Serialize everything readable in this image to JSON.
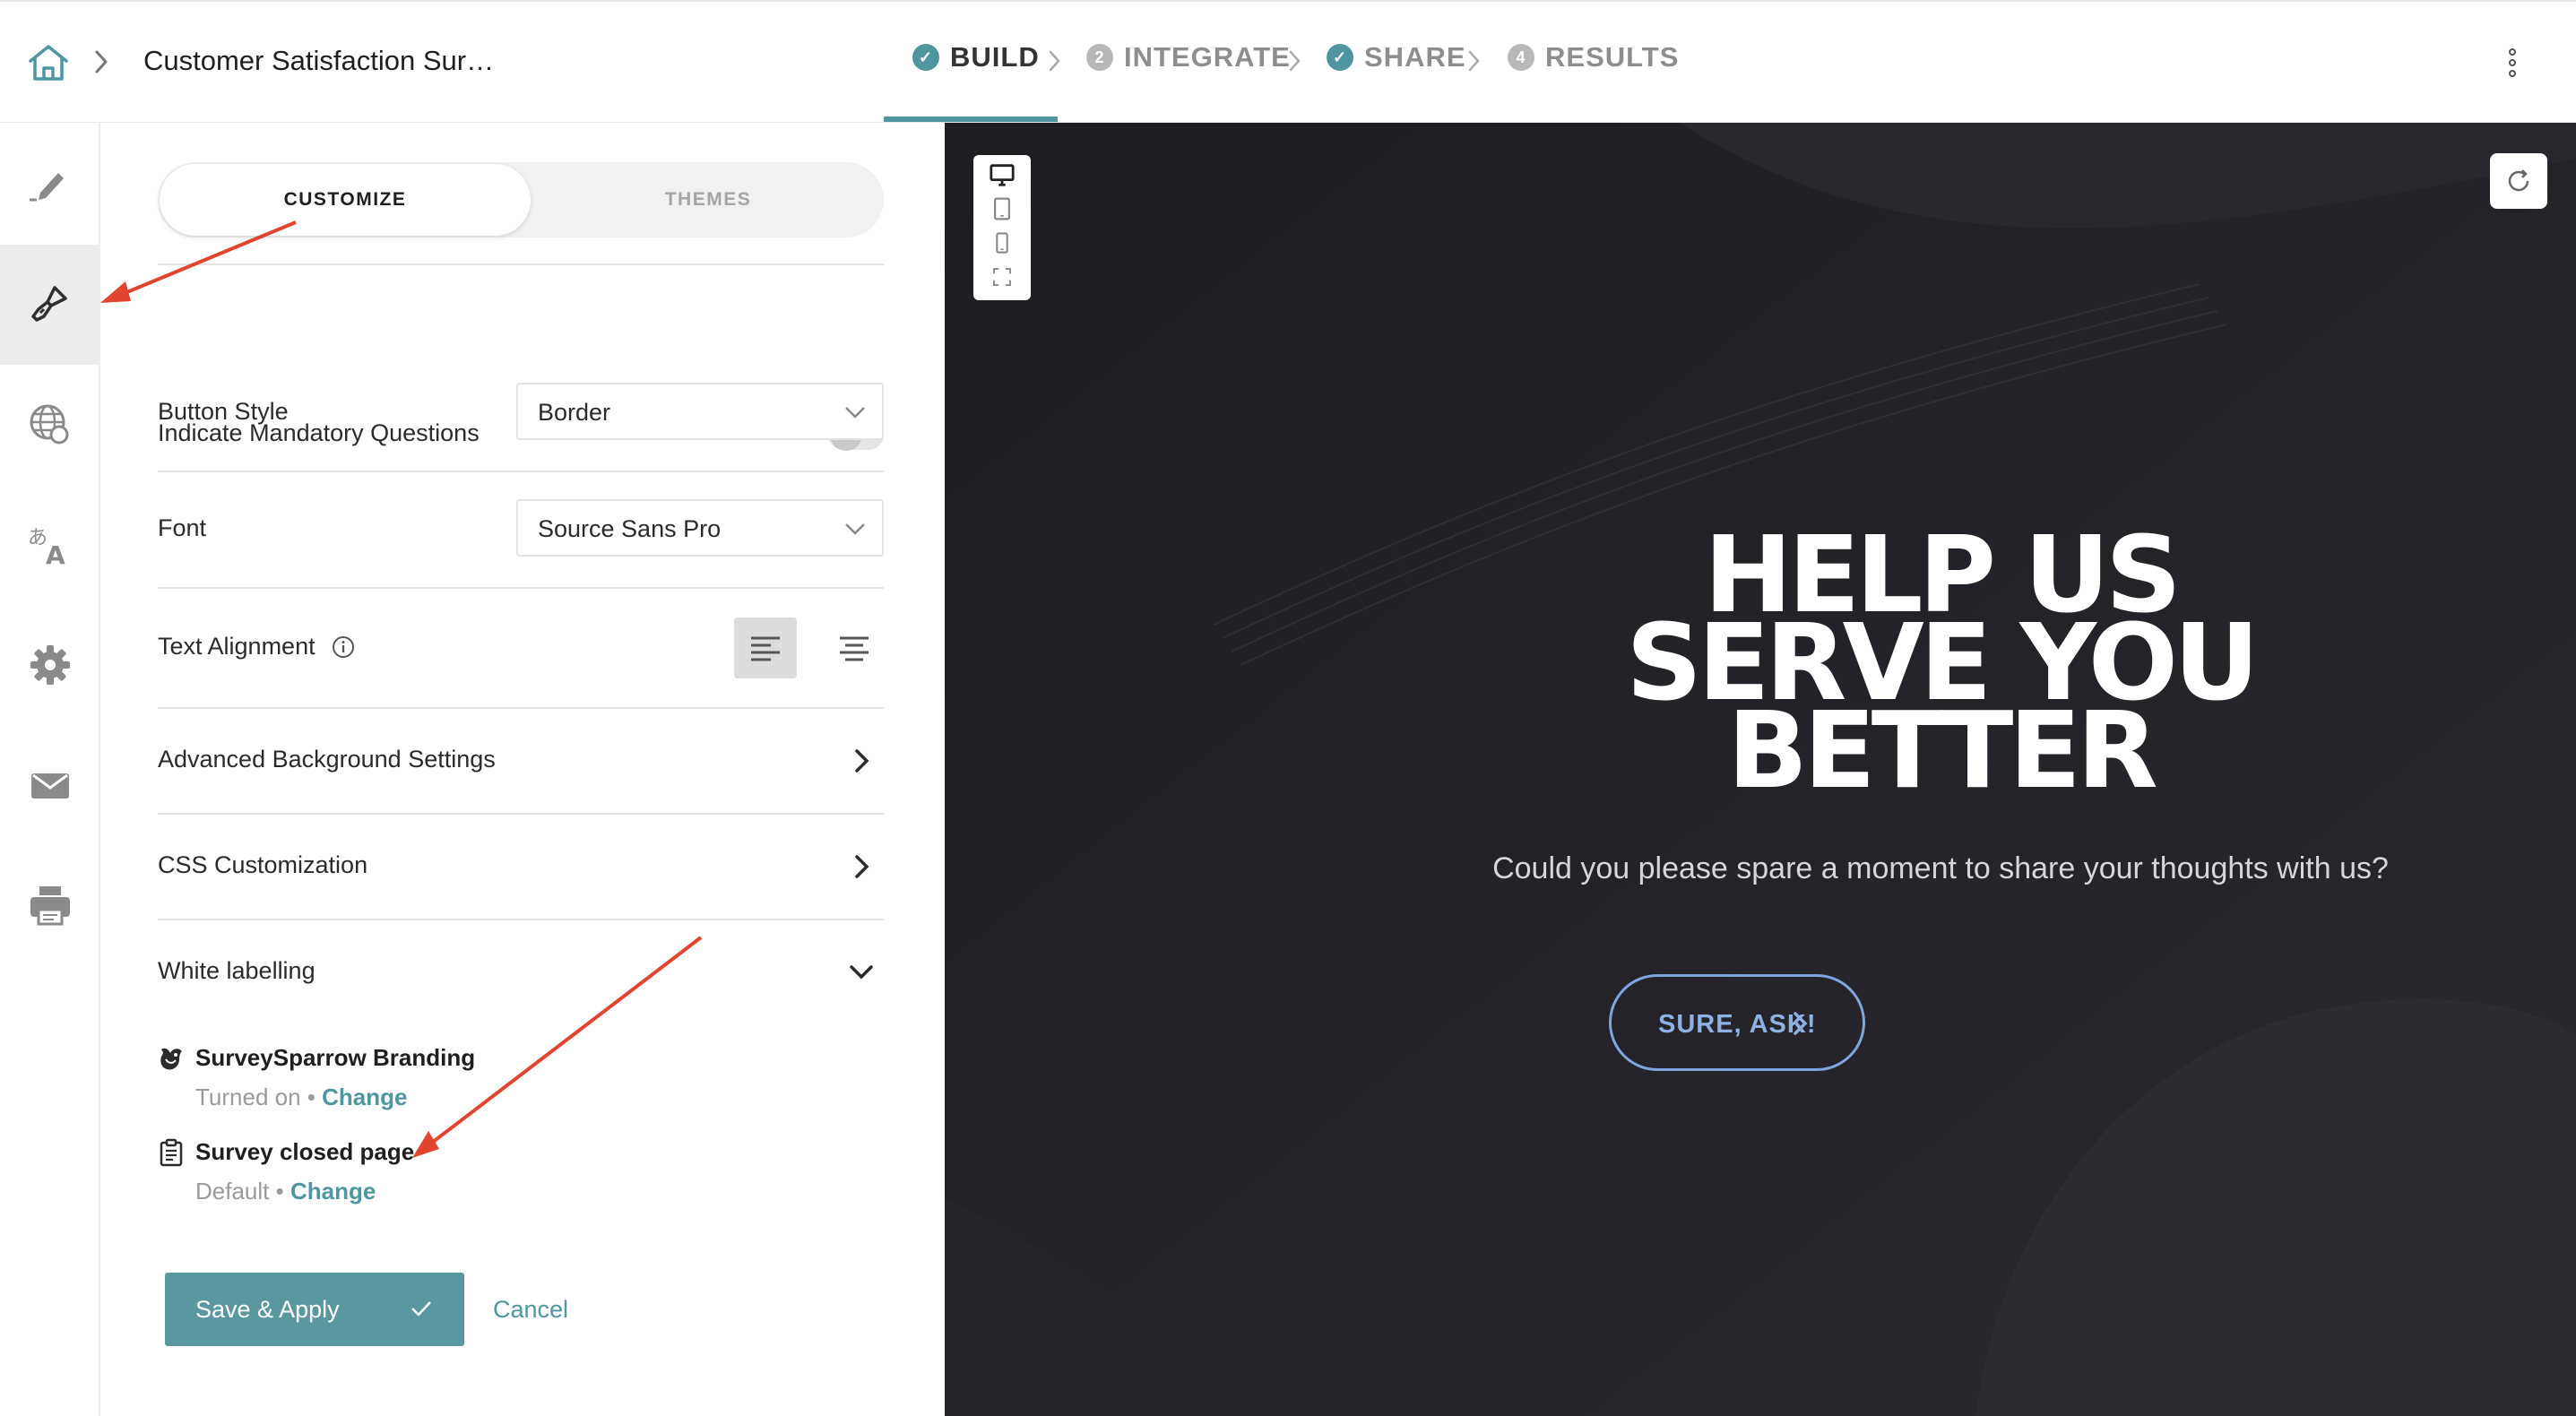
{
  "header": {
    "survey_title": "Customer Satisfaction Sur…",
    "steps": [
      {
        "label": "BUILD",
        "badge": "✓"
      },
      {
        "label": "INTEGRATE",
        "badge": "2"
      },
      {
        "label": "SHARE",
        "badge": "✓"
      },
      {
        "label": "RESULTS",
        "badge": "4"
      }
    ]
  },
  "rail": {
    "items": [
      "pencil-icon",
      "paint-brush-icon",
      "globe-icon",
      "translate-icon",
      "gear-icon",
      "mail-icon",
      "printer-icon"
    ],
    "selected": "paint-brush-icon"
  },
  "panel": {
    "tabs": {
      "customize": "CUSTOMIZE",
      "themes": "THEMES"
    },
    "mandatory_label": "Indicate Mandatory Questions",
    "mandatory_on": false,
    "button_style_label": "Button Style",
    "button_style_value": "Border",
    "font_label": "Font",
    "font_value": "Source Sans Pro",
    "text_alignment_label": "Text Alignment",
    "advanced_bg_label": "Advanced Background Settings",
    "css_label": "CSS Customization",
    "white_label_label": "White labelling",
    "branding": {
      "title": "SurveySparrow Branding",
      "status": "Turned on",
      "dot": " • ",
      "change": "Change"
    },
    "closed_page": {
      "title": "Survey closed page",
      "status": "Default",
      "dot": " • ",
      "change": "Change"
    },
    "save_label": "Save & Apply",
    "cancel_label": "Cancel"
  },
  "preview": {
    "heading_lines": [
      "HELP US",
      "SERVE YOU",
      "BETTER"
    ],
    "subtitle": "Could you please spare a moment to share your thoughts with us?",
    "cta_label": "SURE, ASK!"
  },
  "colors": {
    "accent": "#4f96a1",
    "preview_bg": "#222127",
    "cta_border": "#7fa6dc",
    "annotation_arrow": "#e2452f"
  }
}
